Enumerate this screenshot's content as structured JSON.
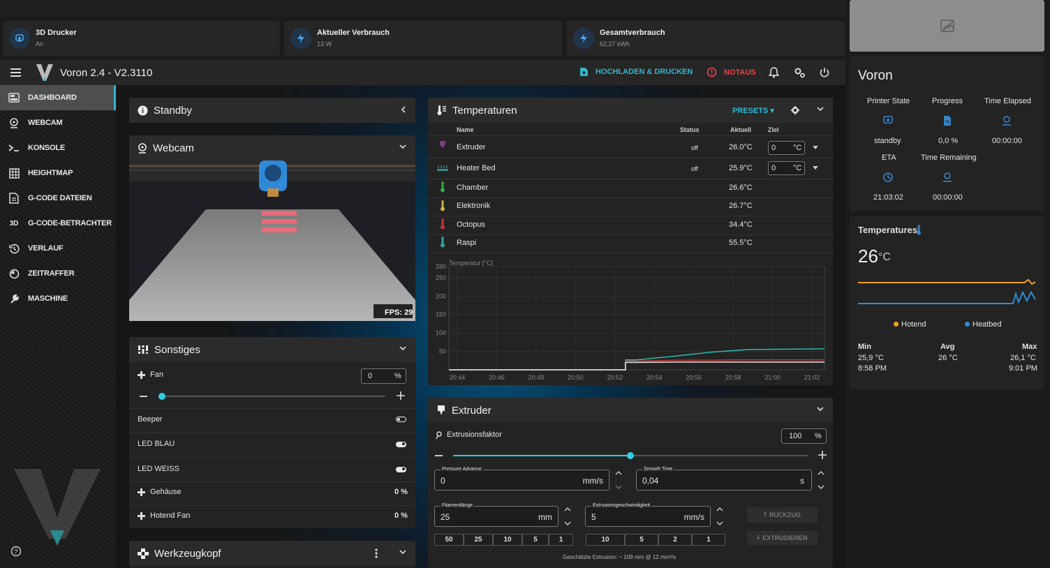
{
  "top_cards": [
    {
      "title": "3D Drucker",
      "sub": "An",
      "icon": "printer-icon"
    },
    {
      "title": "Aktueller Verbrauch",
      "sub": "13 W",
      "icon": "bolt-icon"
    },
    {
      "title": "Gesamtverbrauch",
      "sub": "62,27 kWh",
      "icon": "bolt-icon"
    }
  ],
  "appbar": {
    "title": "Voron 2.4 - V2.3110",
    "upload": "HOCHLADEN & DRUCKEN",
    "estop": "NOTAUS"
  },
  "nav": [
    "DASHBOARD",
    "WEBCAM",
    "KONSOLE",
    "HEIGHTMAP",
    "G-CODE DATEIEN",
    "G-CODE-BETRACHTER",
    "VERLAUF",
    "ZEITRAFFER",
    "MASCHINE"
  ],
  "standby": {
    "title": "Standby"
  },
  "webcam": {
    "title": "Webcam",
    "fps": "FPS: 29"
  },
  "sonstiges": {
    "title": "Sonstiges",
    "fan_label": "Fan",
    "fan_value": "0",
    "fan_unit": "%",
    "fan_level": 0,
    "beeper": "Beeper",
    "led_blau": "LED BLAU",
    "led_weiss": "LED WEISS",
    "gehaeuse": "Gehäuse",
    "gehaeuse_val": "0 %",
    "hotend_fan": "Hotend Fan",
    "hotend_fan_val": "0 %"
  },
  "werkzeugkopf": {
    "title": "Werkzeugkopf"
  },
  "temps": {
    "title": "Temperaturen",
    "presets": "PRESETS",
    "cols": {
      "name": "Name",
      "status": "Status",
      "actual": "Aktuell",
      "target": "Ziel"
    },
    "rows": [
      {
        "name": "Extruder",
        "status": "off",
        "actual": "26.0°C",
        "target": "0",
        "unit": "°C",
        "color": "#7a3a7a"
      },
      {
        "name": "Heater Bed",
        "status": "off",
        "actual": "25.9°C",
        "target": "0",
        "unit": "°C",
        "color": "#3a8a8a"
      },
      {
        "name": "Chamber",
        "actual": "26.6°C",
        "color": "#2fb04a"
      },
      {
        "name": "Elektronik",
        "actual": "26.7°C",
        "color": "#c8b23a"
      },
      {
        "name": "Octopus",
        "actual": "34.4°C",
        "color": "#c03a3a"
      },
      {
        "name": "Raspi",
        "actual": "55.5°C",
        "color": "#2fa8a0"
      }
    ]
  },
  "chart_data": {
    "type": "line",
    "ylabel": "Temperatur [°C]",
    "ylim": [
      0,
      280
    ],
    "yticks": [
      "280",
      "250",
      "200",
      "150",
      "100",
      "50"
    ],
    "x": [
      "20:44",
      "20:46",
      "20:48",
      "20:50",
      "20:52",
      "20:54",
      "20:56",
      "20:58",
      "21:00",
      "21:02"
    ],
    "series": [
      {
        "color": "#2fb8b0",
        "values": [
          0,
          0,
          0,
          0,
          0,
          27,
          37,
          48,
          55,
          56,
          57
        ]
      },
      {
        "color": "#c03a3a",
        "values": [
          0,
          0,
          0,
          0,
          0,
          24,
          26,
          26,
          27,
          27,
          27
        ]
      },
      {
        "color": "#e8e8e8",
        "values": [
          0,
          0,
          0,
          0,
          0,
          20,
          21,
          21,
          21,
          21,
          21
        ]
      }
    ]
  },
  "extruder": {
    "title": "Extruder",
    "faktor_label": "Extrusionsfaktor",
    "faktor_value": "100",
    "faktor_unit": "%",
    "faktor_level": 0.5,
    "pa_label": "Pressure Advance",
    "pa_value": "0",
    "pa_unit": "mm/s",
    "st_label": "Smooth Time",
    "st_value": "0,04",
    "st_unit": "s",
    "fl_label": "Filamentlänge",
    "fl_value": "25",
    "fl_unit": "mm",
    "eg_label": "Extrusionsgeschwindigkeit",
    "eg_value": "5",
    "eg_unit": "mm/s",
    "retract": "RÜCKZUG",
    "extrude": "EXTRUDIEREN",
    "len_buttons": [
      "50",
      "25",
      "10",
      "5",
      "1"
    ],
    "speed_buttons": [
      "10",
      "5",
      "2",
      "1"
    ],
    "estimate": "Geschätzte Extrusion: ~ 109 mm @ 12 mm³/s"
  },
  "voron_card": {
    "title": "Voron",
    "labels": [
      "Printer State",
      "Progress",
      "Time Elapsed",
      "ETA",
      "Time Remaining"
    ],
    "values": [
      "standby",
      "0,0 %",
      "00:00:00",
      "21:03:02",
      "00:00:00"
    ]
  },
  "temp_card": {
    "title": "Temperatures",
    "value": "26",
    "unit": "°C",
    "legend": [
      "Hotend",
      "Heatbed"
    ],
    "legend_colors": [
      "#f0a020",
      "#2f8ed0"
    ],
    "min_label": "Min",
    "min_val": "25,9 °C",
    "min_time": "8:58 PM",
    "avg_label": "Avg",
    "avg_val": "26 °C",
    "max_label": "Max",
    "max_val": "26,1 °C",
    "max_time": "9:01 PM"
  }
}
